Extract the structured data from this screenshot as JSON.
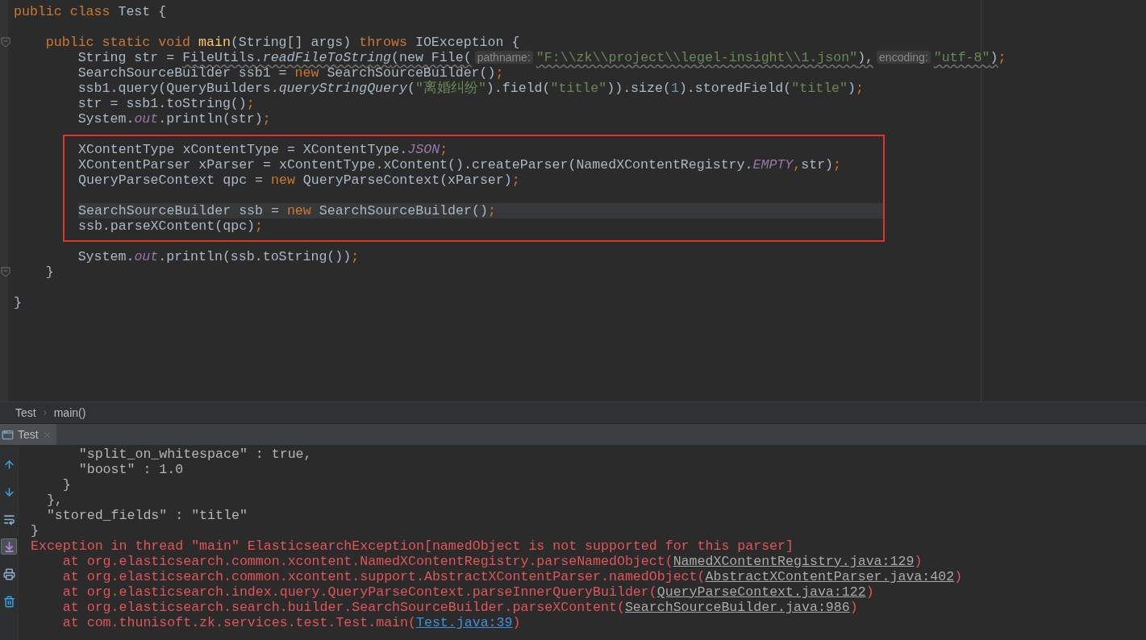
{
  "editor": {
    "lines": [
      {
        "kind": "code",
        "tokens": [
          {
            "text": "public class",
            "kind": "keyword"
          },
          {
            "text": " Test {",
            "kind": "plain"
          }
        ]
      },
      {
        "kind": "blank"
      },
      {
        "kind": "code",
        "fold": true,
        "tokens": [
          {
            "text": "    public static void ",
            "kind": "keyword"
          },
          {
            "text": "main",
            "kind": "method"
          },
          {
            "text": "(String[] args) ",
            "kind": "plain"
          },
          {
            "text": "throws ",
            "kind": "keyword"
          },
          {
            "text": "IOException {",
            "kind": "plain"
          }
        ]
      },
      {
        "kind": "code",
        "tokens": [
          {
            "text": "        String str = ",
            "kind": "plain"
          },
          {
            "text": "FileUtils.",
            "kind": "plain",
            "underlined": true
          },
          {
            "text": "readFileToString",
            "kind": "static",
            "underlined": true
          },
          {
            "text": "(new File(",
            "kind": "plain",
            "underlined": true
          },
          {
            "text": "pathname:",
            "kind": "hint"
          },
          {
            "text": "\"F:\\\\zk\\\\project\\\\legel-insight\\\\1.json\"",
            "kind": "string",
            "underlined": true
          },
          {
            "text": "),",
            "kind": "plain",
            "underlined": true
          },
          {
            "text": "encoding:",
            "kind": "hint"
          },
          {
            "text": "\"utf-8\"",
            "kind": "string",
            "underlined": true
          },
          {
            "text": ")",
            "kind": "plain",
            "underlined": true
          },
          {
            "text": ";",
            "kind": "keyword"
          }
        ]
      },
      {
        "kind": "code",
        "tokens": [
          {
            "text": "        SearchSourceBuilder ssb1 = ",
            "kind": "plain"
          },
          {
            "text": "new ",
            "kind": "keyword"
          },
          {
            "text": "SearchSourceBuilder()",
            "kind": "plain"
          },
          {
            "text": ";",
            "kind": "keyword"
          }
        ]
      },
      {
        "kind": "code",
        "tokens": [
          {
            "text": "        ssb1.query(QueryBuilders.",
            "kind": "plain"
          },
          {
            "text": "queryStringQuery",
            "kind": "static"
          },
          {
            "text": "(",
            "kind": "plain"
          },
          {
            "text": "\"离婚纠纷\"",
            "kind": "string"
          },
          {
            "text": ").field(",
            "kind": "plain"
          },
          {
            "text": "\"title\"",
            "kind": "string"
          },
          {
            "text": ")).size(",
            "kind": "plain"
          },
          {
            "text": "1",
            "kind": "number"
          },
          {
            "text": ").storedField(",
            "kind": "plain"
          },
          {
            "text": "\"title\"",
            "kind": "string"
          },
          {
            "text": ")",
            "kind": "plain"
          },
          {
            "text": ";",
            "kind": "keyword"
          }
        ]
      },
      {
        "kind": "code",
        "tokens": [
          {
            "text": "        str = ssb1.toString()",
            "kind": "plain"
          },
          {
            "text": ";",
            "kind": "keyword"
          }
        ]
      },
      {
        "kind": "code",
        "tokens": [
          {
            "text": "        System.",
            "kind": "plain"
          },
          {
            "text": "out",
            "kind": "field"
          },
          {
            "text": ".println(str)",
            "kind": "plain"
          },
          {
            "text": ";",
            "kind": "keyword"
          }
        ]
      },
      {
        "kind": "frame",
        "lines": [
          {
            "kind": "code",
            "current": false,
            "tokens": [
              {
                "text": "XContentType xContentType = XContentType.",
                "kind": "plain"
              },
              {
                "text": "JSON",
                "kind": "field"
              },
              {
                "text": ";",
                "kind": "keyword"
              }
            ]
          },
          {
            "kind": "code",
            "current": false,
            "tokens": [
              {
                "text": "XContentParser xParser = xContentType.xContent().createParser(NamedXContentRegistry.",
                "kind": "plain"
              },
              {
                "text": "EMPTY",
                "kind": "field"
              },
              {
                "text": ",",
                "kind": "keyword"
              },
              {
                "text": "str)",
                "kind": "plain"
              },
              {
                "text": ";",
                "kind": "keyword"
              }
            ]
          },
          {
            "kind": "code",
            "current": false,
            "tokens": [
              {
                "text": "QueryParseContext qpc = ",
                "kind": "plain"
              },
              {
                "text": "new ",
                "kind": "keyword"
              },
              {
                "text": "QueryParseContext(xParser)",
                "kind": "plain"
              },
              {
                "text": ";",
                "kind": "keyword"
              }
            ]
          },
          {
            "kind": "blank"
          },
          {
            "kind": "code",
            "current": true,
            "tokens": [
              {
                "text": "SearchSourceBuilder ssb = ",
                "kind": "plain"
              },
              {
                "text": "new ",
                "kind": "keyword"
              },
              {
                "text": "SearchSourceBuilder()",
                "kind": "plain"
              },
              {
                "text": ";",
                "kind": "keyword"
              }
            ]
          },
          {
            "kind": "code",
            "current": false,
            "tokens": [
              {
                "text": "ssb.parseXContent(qpc)",
                "kind": "plain"
              },
              {
                "text": ";",
                "kind": "keyword"
              }
            ]
          }
        ]
      },
      {
        "kind": "code",
        "tokens": [
          {
            "text": "        System.",
            "kind": "plain"
          },
          {
            "text": "out",
            "kind": "field"
          },
          {
            "text": ".println(ssb.toString())",
            "kind": "plain"
          },
          {
            "text": ";",
            "kind": "keyword"
          }
        ]
      },
      {
        "kind": "code",
        "fold": true,
        "tokens": [
          {
            "text": "    }",
            "kind": "plain"
          }
        ]
      },
      {
        "kind": "blank"
      },
      {
        "kind": "code",
        "tokens": [
          {
            "text": "}",
            "kind": "plain"
          }
        ]
      }
    ]
  },
  "breadcrumb": [
    "Test",
    "main()"
  ],
  "tabs": [
    {
      "label": "Test",
      "selected": true
    }
  ],
  "console": {
    "toolbar": [
      {
        "on": false
      },
      {
        "on": false
      },
      {
        "on": false
      },
      {
        "on": true
      },
      {
        "on": false
      },
      {
        "on": false
      }
    ],
    "lines": [
      {
        "kind": "output",
        "text": "      \"split_on_whitespace\" : true,"
      },
      {
        "kind": "output",
        "text": "      \"boost\" : 1.0"
      },
      {
        "kind": "output",
        "text": "    }"
      },
      {
        "kind": "output",
        "text": "  },"
      },
      {
        "kind": "output",
        "text": "  \"stored_fields\" : \"title\""
      },
      {
        "kind": "output",
        "text": "}"
      },
      {
        "kind": "error",
        "text": "Exception in thread \"main\" ElasticsearchException[namedObject is not supported for this parser]"
      },
      {
        "kind": "stack",
        "text": "    at org.elasticsearch.common.xcontent.NamedXContentRegistry.parseNamedObject(",
        "link": {
          "text": "NamedXContentRegistry.java:129",
          "kind": "library"
        },
        "tail": ")"
      },
      {
        "kind": "stack",
        "text": "    at org.elasticsearch.common.xcontent.support.AbstractXContentParser.namedObject(",
        "link": {
          "text": "AbstractXContentParser.java:402",
          "kind": "library"
        },
        "tail": ")"
      },
      {
        "kind": "stack",
        "text": "    at org.elasticsearch.index.query.QueryParseContext.parseInnerQueryBuilder(",
        "link": {
          "text": "QueryParseContext.java:122",
          "kind": "library"
        },
        "tail": ")"
      },
      {
        "kind": "stack",
        "text": "    at org.elasticsearch.search.builder.SearchSourceBuilder.parseXContent(",
        "link": {
          "text": "SearchSourceBuilder.java:986",
          "kind": "library"
        },
        "tail": ")"
      },
      {
        "kind": "stack",
        "text": "    at com.thunisoft.zk.services.test.Test.main(",
        "link": {
          "text": "Test.java:39",
          "kind": "project"
        },
        "tail": ")"
      }
    ]
  }
}
